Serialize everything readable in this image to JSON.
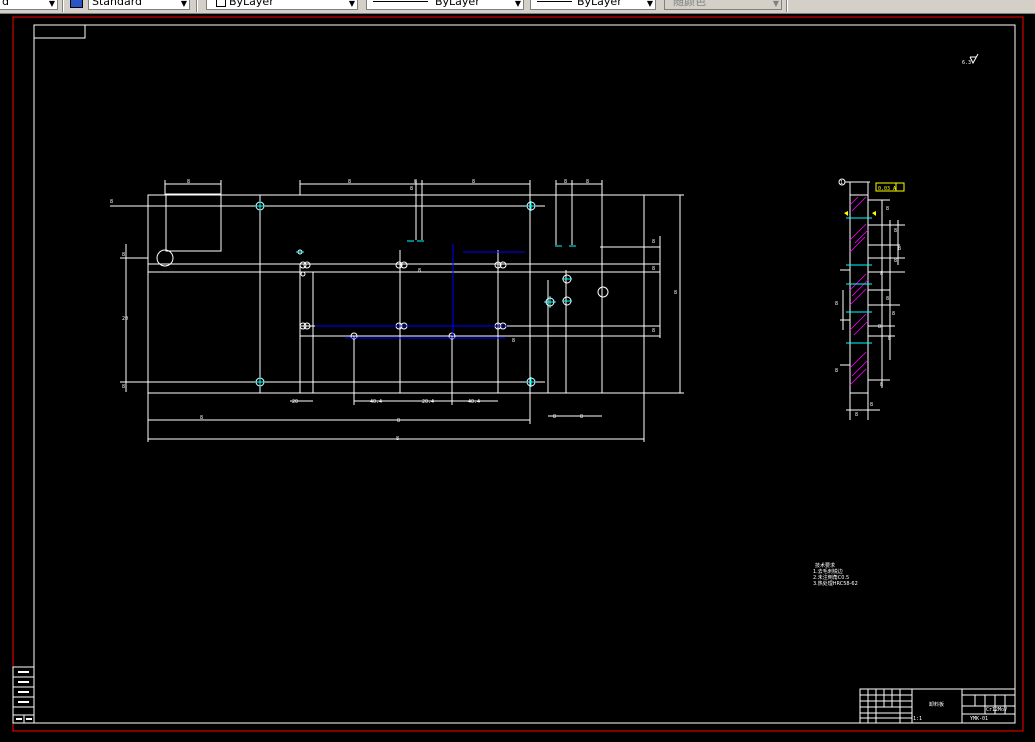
{
  "toolbar": {
    "items": [
      {
        "id": "textstyle",
        "value": "d"
      },
      {
        "id": "dimstyle",
        "value": "Standard"
      },
      {
        "id": "color",
        "value": "ByLayer"
      },
      {
        "id": "linetype",
        "value": "ByLayer"
      },
      {
        "id": "lineweight",
        "value": "ByLayer"
      },
      {
        "id": "plotstyle",
        "value": "随颜色"
      }
    ]
  },
  "drawing": {
    "colors": {
      "background": "#000000",
      "border_red": "#ff0000",
      "geometry": "#ffffff",
      "cyan": "#00ffff",
      "blue": "#0000ff",
      "yellow": "#ffff00",
      "magenta": "#ff00ff"
    },
    "dims": {
      "d1": "8",
      "d2": "8",
      "d3": "8",
      "d4": "8",
      "d5": "8",
      "d6": "8",
      "d7": "8",
      "d8": "20",
      "d9": "8",
      "d10": "8",
      "d11": "8",
      "d12": "8",
      "d13": "8",
      "d14": "8",
      "d15": "40.4",
      "d16": "20.4",
      "d17": "40.4",
      "d18": "20",
      "d19": "8",
      "d20": "8",
      "d21": "8",
      "d22": "8",
      "d23": "8",
      "d24": "8",
      "d25": "8",
      "d26": "8"
    },
    "section": {
      "marker": "1",
      "tolerance": "0.03 A",
      "labels": [
        "8",
        "8",
        "8",
        "8",
        "8",
        "8",
        "8",
        "8",
        "8",
        "8",
        "8",
        "8",
        "8",
        "8"
      ]
    },
    "notes": {
      "heading": "技术要求",
      "lines": [
        "1.去毛刺锐边",
        "2.未注倒角C0.5",
        "3.热处理HRC58-62"
      ]
    },
    "surface_roughness": "6.3",
    "title_block": {
      "part_name": "卸料板",
      "drawing_no": "YMK-01",
      "material": "Cr12MoV",
      "scale": "1:1"
    }
  }
}
